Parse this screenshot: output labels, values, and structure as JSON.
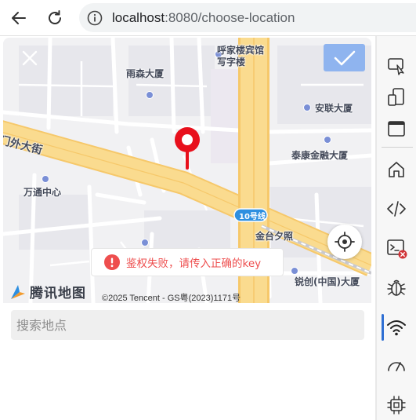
{
  "browser": {
    "url_host": "localhost",
    "url_rest": ":8080/choose-location"
  },
  "map": {
    "labels": {
      "hujialou": "呼家楼宾馆\n写字楼",
      "yusen": "雨森大厦",
      "anlian": "安联大厦",
      "road_west": "门外大街",
      "taikang": "泰康金融大厦",
      "wantong": "万通中心",
      "ring_road": "10号线",
      "jintaixizhao": "金台夕照",
      "ruichuang": "锐创(中国)大厦"
    },
    "error_message": "鉴权失败，请传入正确的key",
    "logo_text": "腾讯地图",
    "copyright": "©2025 Tencent - GS粤(2023)1171号"
  },
  "search": {
    "placeholder": "搜索地点"
  },
  "colors": {
    "accent": "#8fb4ef",
    "pin": "#e8101c",
    "error": "#ee4e4e"
  },
  "devtools": {
    "active_panel": "network-icon"
  }
}
